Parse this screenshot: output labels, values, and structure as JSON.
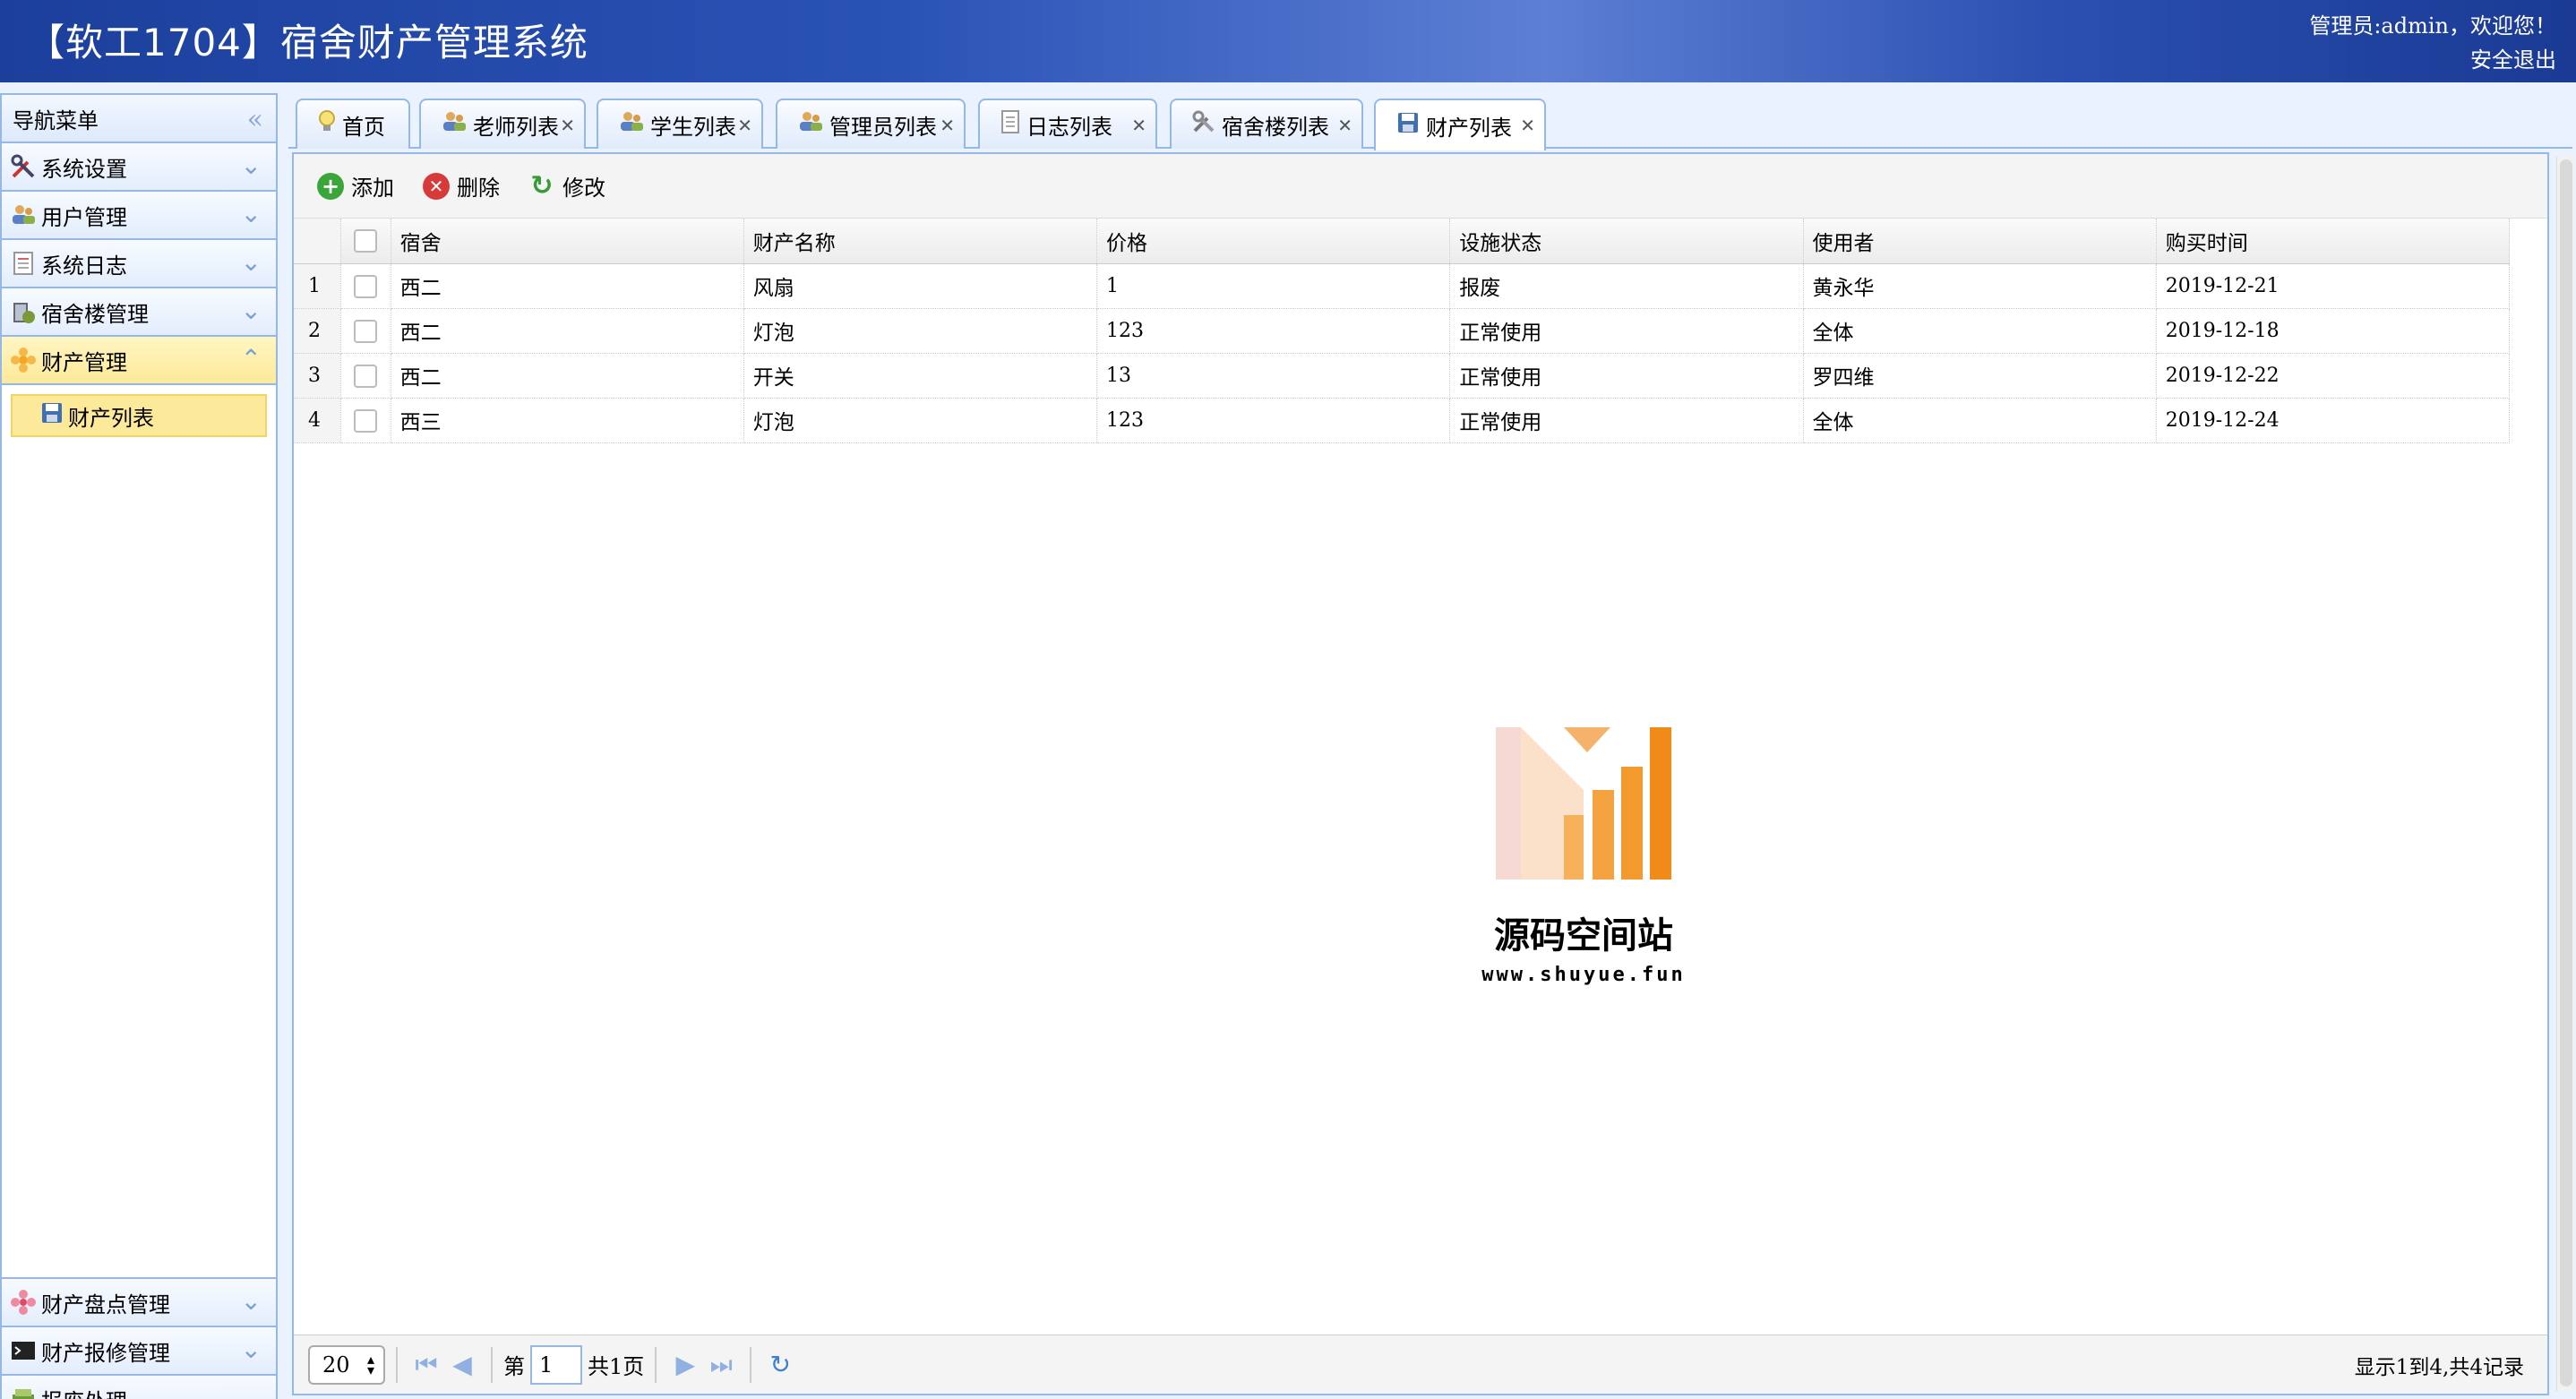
{
  "header": {
    "title": "【软工1704】宿舍财产管理系统",
    "greeting": "管理员:admin，欢迎您！",
    "logout": "安全退出"
  },
  "sidebar": {
    "title": "导航菜单",
    "items": [
      {
        "label": "系统设置",
        "icon": "tools-icon"
      },
      {
        "label": "用户管理",
        "icon": "users-icon"
      },
      {
        "label": "系统日志",
        "icon": "log-icon"
      },
      {
        "label": "宿舍楼管理",
        "icon": "building-icon"
      },
      {
        "label": "财产管理",
        "icon": "asset-icon"
      }
    ],
    "sub_items": [
      {
        "label": "财产列表",
        "icon": "save-icon"
      }
    ],
    "bottom_items": [
      {
        "label": "财产盘点管理",
        "icon": "flower-icon"
      },
      {
        "label": "财产报修管理",
        "icon": "terminal-icon"
      },
      {
        "label": "报废处理",
        "icon": "box-icon"
      }
    ]
  },
  "tabs": [
    {
      "label": "首页",
      "closable": false
    },
    {
      "label": "老师列表",
      "closable": true
    },
    {
      "label": "学生列表",
      "closable": true
    },
    {
      "label": "管理员列表",
      "closable": true
    },
    {
      "label": "日志列表",
      "closable": true
    },
    {
      "label": "宿舍楼列表",
      "closable": true
    },
    {
      "label": "财产列表",
      "closable": true
    }
  ],
  "toolbar": {
    "add": "添加",
    "delete": "删除",
    "edit": "修改"
  },
  "table": {
    "columns": [
      "宿舍",
      "财产名称",
      "价格",
      "设施状态",
      "使用者",
      "购买时间"
    ],
    "rows": [
      {
        "n": "1",
        "cells": [
          "西二",
          "风扇",
          "1",
          "报废",
          "黄永华",
          "2019-12-21"
        ]
      },
      {
        "n": "2",
        "cells": [
          "西二",
          "灯泡",
          "123",
          "正常使用",
          "全体",
          "2019-12-18"
        ]
      },
      {
        "n": "3",
        "cells": [
          "西二",
          "开关",
          "13",
          "正常使用",
          "罗四维",
          "2019-12-22"
        ]
      },
      {
        "n": "4",
        "cells": [
          "西三",
          "灯泡",
          "123",
          "正常使用",
          "全体",
          "2019-12-24"
        ]
      }
    ]
  },
  "watermark": {
    "title": "源码空间站",
    "url": "www.shuyue.fun"
  },
  "pager": {
    "page_size": "20",
    "page_prefix": "第",
    "page_value": "1",
    "page_total": "共1页",
    "info": "显示1到4,共4记录"
  },
  "colors": {
    "header": "#2a53b6",
    "border": "#95b8e7",
    "active": "#fde99a",
    "brand_orange": "#f39a2e"
  }
}
